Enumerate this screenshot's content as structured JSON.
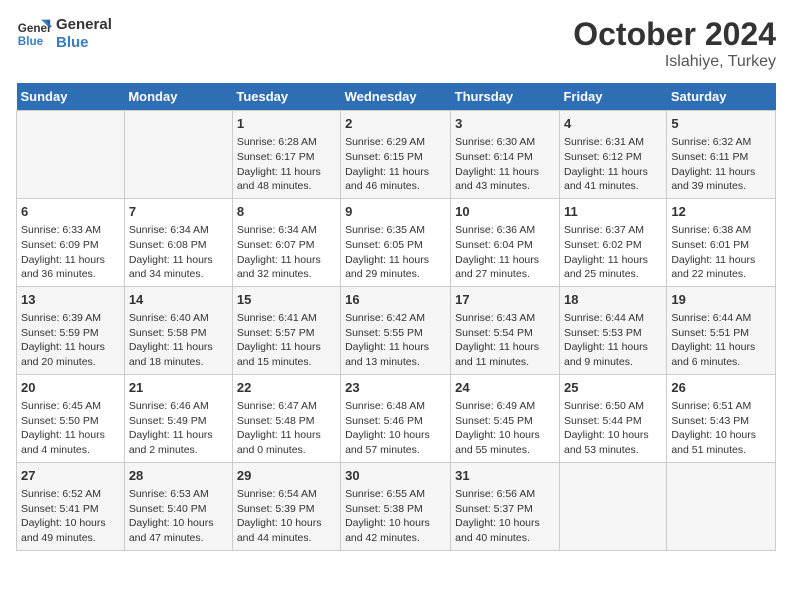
{
  "header": {
    "logo": {
      "line1": "General",
      "line2": "Blue"
    },
    "title": "October 2024",
    "subtitle": "Islahiye, Turkey"
  },
  "days_of_week": [
    "Sunday",
    "Monday",
    "Tuesday",
    "Wednesday",
    "Thursday",
    "Friday",
    "Saturday"
  ],
  "weeks": [
    [
      {
        "day": "",
        "info": ""
      },
      {
        "day": "",
        "info": ""
      },
      {
        "day": "1",
        "info": "Sunrise: 6:28 AM\nSunset: 6:17 PM\nDaylight: 11 hours and 48 minutes."
      },
      {
        "day": "2",
        "info": "Sunrise: 6:29 AM\nSunset: 6:15 PM\nDaylight: 11 hours and 46 minutes."
      },
      {
        "day": "3",
        "info": "Sunrise: 6:30 AM\nSunset: 6:14 PM\nDaylight: 11 hours and 43 minutes."
      },
      {
        "day": "4",
        "info": "Sunrise: 6:31 AM\nSunset: 6:12 PM\nDaylight: 11 hours and 41 minutes."
      },
      {
        "day": "5",
        "info": "Sunrise: 6:32 AM\nSunset: 6:11 PM\nDaylight: 11 hours and 39 minutes."
      }
    ],
    [
      {
        "day": "6",
        "info": "Sunrise: 6:33 AM\nSunset: 6:09 PM\nDaylight: 11 hours and 36 minutes."
      },
      {
        "day": "7",
        "info": "Sunrise: 6:34 AM\nSunset: 6:08 PM\nDaylight: 11 hours and 34 minutes."
      },
      {
        "day": "8",
        "info": "Sunrise: 6:34 AM\nSunset: 6:07 PM\nDaylight: 11 hours and 32 minutes."
      },
      {
        "day": "9",
        "info": "Sunrise: 6:35 AM\nSunset: 6:05 PM\nDaylight: 11 hours and 29 minutes."
      },
      {
        "day": "10",
        "info": "Sunrise: 6:36 AM\nSunset: 6:04 PM\nDaylight: 11 hours and 27 minutes."
      },
      {
        "day": "11",
        "info": "Sunrise: 6:37 AM\nSunset: 6:02 PM\nDaylight: 11 hours and 25 minutes."
      },
      {
        "day": "12",
        "info": "Sunrise: 6:38 AM\nSunset: 6:01 PM\nDaylight: 11 hours and 22 minutes."
      }
    ],
    [
      {
        "day": "13",
        "info": "Sunrise: 6:39 AM\nSunset: 5:59 PM\nDaylight: 11 hours and 20 minutes."
      },
      {
        "day": "14",
        "info": "Sunrise: 6:40 AM\nSunset: 5:58 PM\nDaylight: 11 hours and 18 minutes."
      },
      {
        "day": "15",
        "info": "Sunrise: 6:41 AM\nSunset: 5:57 PM\nDaylight: 11 hours and 15 minutes."
      },
      {
        "day": "16",
        "info": "Sunrise: 6:42 AM\nSunset: 5:55 PM\nDaylight: 11 hours and 13 minutes."
      },
      {
        "day": "17",
        "info": "Sunrise: 6:43 AM\nSunset: 5:54 PM\nDaylight: 11 hours and 11 minutes."
      },
      {
        "day": "18",
        "info": "Sunrise: 6:44 AM\nSunset: 5:53 PM\nDaylight: 11 hours and 9 minutes."
      },
      {
        "day": "19",
        "info": "Sunrise: 6:44 AM\nSunset: 5:51 PM\nDaylight: 11 hours and 6 minutes."
      }
    ],
    [
      {
        "day": "20",
        "info": "Sunrise: 6:45 AM\nSunset: 5:50 PM\nDaylight: 11 hours and 4 minutes."
      },
      {
        "day": "21",
        "info": "Sunrise: 6:46 AM\nSunset: 5:49 PM\nDaylight: 11 hours and 2 minutes."
      },
      {
        "day": "22",
        "info": "Sunrise: 6:47 AM\nSunset: 5:48 PM\nDaylight: 11 hours and 0 minutes."
      },
      {
        "day": "23",
        "info": "Sunrise: 6:48 AM\nSunset: 5:46 PM\nDaylight: 10 hours and 57 minutes."
      },
      {
        "day": "24",
        "info": "Sunrise: 6:49 AM\nSunset: 5:45 PM\nDaylight: 10 hours and 55 minutes."
      },
      {
        "day": "25",
        "info": "Sunrise: 6:50 AM\nSunset: 5:44 PM\nDaylight: 10 hours and 53 minutes."
      },
      {
        "day": "26",
        "info": "Sunrise: 6:51 AM\nSunset: 5:43 PM\nDaylight: 10 hours and 51 minutes."
      }
    ],
    [
      {
        "day": "27",
        "info": "Sunrise: 6:52 AM\nSunset: 5:41 PM\nDaylight: 10 hours and 49 minutes."
      },
      {
        "day": "28",
        "info": "Sunrise: 6:53 AM\nSunset: 5:40 PM\nDaylight: 10 hours and 47 minutes."
      },
      {
        "day": "29",
        "info": "Sunrise: 6:54 AM\nSunset: 5:39 PM\nDaylight: 10 hours and 44 minutes."
      },
      {
        "day": "30",
        "info": "Sunrise: 6:55 AM\nSunset: 5:38 PM\nDaylight: 10 hours and 42 minutes."
      },
      {
        "day": "31",
        "info": "Sunrise: 6:56 AM\nSunset: 5:37 PM\nDaylight: 10 hours and 40 minutes."
      },
      {
        "day": "",
        "info": ""
      },
      {
        "day": "",
        "info": ""
      }
    ]
  ]
}
